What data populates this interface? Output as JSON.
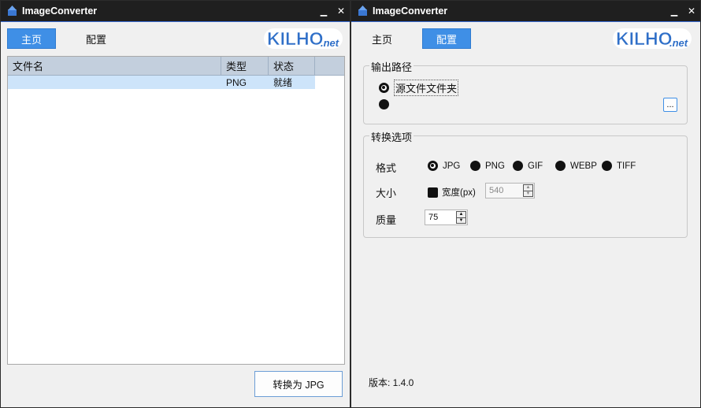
{
  "app_title": "ImageConverter",
  "left_window": {
    "tabs": [
      {
        "label": "主页",
        "active": true
      },
      {
        "label": "配置",
        "active": false
      }
    ],
    "file_list": {
      "columns": [
        "文件名",
        "类型",
        "状态"
      ],
      "rows": [
        {
          "name": "",
          "type": "PNG",
          "status": "就绪"
        }
      ]
    },
    "convert_button": "转换为 JPG"
  },
  "right_window": {
    "tabs": [
      {
        "label": "主页",
        "active": false
      },
      {
        "label": "配置",
        "active": true
      }
    ],
    "output_path": {
      "title": "输出路径",
      "source_folder_label": "源文件文件夹",
      "browse_button": "..."
    },
    "convert_options": {
      "title": "转换选项",
      "format_label": "格式",
      "formats": [
        "JPG",
        "PNG",
        "GIF",
        "WEBP",
        "TIFF"
      ],
      "selected_format": "JPG",
      "size_label": "大小",
      "width_checkbox_label": "宽度(px)",
      "width_value": "540",
      "quality_label": "质量",
      "quality_value": "75"
    },
    "version_text": "版本: 1.4.0"
  },
  "logo_text": "KILHO.net",
  "icons": {
    "app": "app-upload-icon",
    "minimize": "minimize-icon",
    "close": "close-icon"
  },
  "colors": {
    "accent": "#3f8fe6",
    "titlebar": "#1f1f1f",
    "logo_blue": "#2f6fc8",
    "list_header": "#c3cfdd",
    "row_selected": "#cde4fa"
  }
}
